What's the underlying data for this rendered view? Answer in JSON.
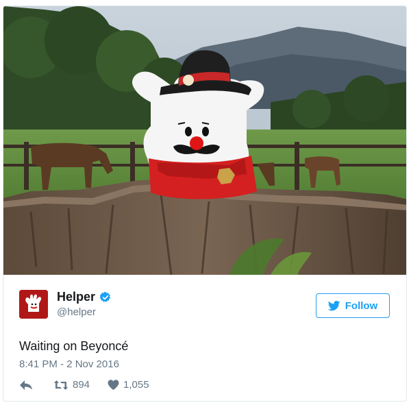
{
  "user": {
    "name": "Helper",
    "handle": "@helper"
  },
  "follow_label": "Follow",
  "tweet": {
    "text": "Waiting on Beyoncé",
    "timestamp": "8:41 PM - 2 Nov 2016"
  },
  "stats": {
    "retweets": "894",
    "likes": "1,055"
  },
  "colors": {
    "brand_blue": "#1da1f2",
    "text_dark": "#14171a",
    "text_gray": "#657786",
    "avatar_red": "#b01818"
  },
  "icons": {
    "reply": "reply-icon",
    "retweet": "retweet-icon",
    "like": "heart-icon",
    "verified": "verified-badge-icon",
    "bird": "twitter-bird-icon"
  }
}
